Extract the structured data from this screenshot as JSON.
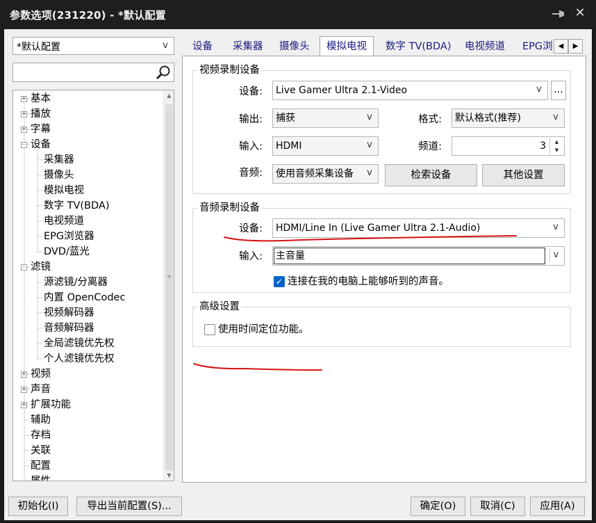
{
  "window": {
    "title": "参数选项(231220) - *默认配置"
  },
  "left": {
    "profile_value": "*默认配置",
    "search_placeholder": "",
    "tree": [
      {
        "label": "基本",
        "level": 0,
        "expander": "+"
      },
      {
        "label": "播放",
        "level": 0,
        "expander": "+"
      },
      {
        "label": "字幕",
        "level": 0,
        "expander": "+"
      },
      {
        "label": "设备",
        "level": 0,
        "expander": "-"
      },
      {
        "label": "采集器",
        "level": 1,
        "expander": ""
      },
      {
        "label": "摄像头",
        "level": 1,
        "expander": ""
      },
      {
        "label": "模拟电视",
        "level": 1,
        "expander": ""
      },
      {
        "label": "数字 TV(BDA)",
        "level": 1,
        "expander": ""
      },
      {
        "label": "电视频道",
        "level": 1,
        "expander": ""
      },
      {
        "label": "EPG浏览器",
        "level": 1,
        "expander": ""
      },
      {
        "label": "DVD/蓝光",
        "level": 1,
        "expander": ""
      },
      {
        "label": "滤镜",
        "level": 0,
        "expander": "-"
      },
      {
        "label": "源滤镜/分离器",
        "level": 1,
        "expander": ""
      },
      {
        "label": "内置 OpenCodec",
        "level": 1,
        "expander": ""
      },
      {
        "label": "视频解码器",
        "level": 1,
        "expander": ""
      },
      {
        "label": "音频解码器",
        "level": 1,
        "expander": ""
      },
      {
        "label": "全局滤镜优先权",
        "level": 1,
        "expander": ""
      },
      {
        "label": "个人滤镜优先权",
        "level": 1,
        "expander": ""
      },
      {
        "label": "视频",
        "level": 0,
        "expander": "+"
      },
      {
        "label": "声音",
        "level": 0,
        "expander": "+"
      },
      {
        "label": "扩展功能",
        "level": 0,
        "expander": "+"
      },
      {
        "label": "辅助",
        "level": 0,
        "expander": ""
      },
      {
        "label": "存档",
        "level": 0,
        "expander": ""
      },
      {
        "label": "关联",
        "level": 0,
        "expander": ""
      },
      {
        "label": "配置",
        "level": 0,
        "expander": ""
      },
      {
        "label": "属性",
        "level": 0,
        "expander": ""
      }
    ]
  },
  "tabs": [
    "设备",
    "采集器",
    "摄像头",
    "模拟电视",
    "数字 TV(BDA)",
    "电视频道",
    "EPG浏"
  ],
  "video_group": {
    "title": "视频录制设备",
    "device_label": "设备:",
    "device_value": "Live Gamer Ultra 2.1-Video",
    "more_btn": "...",
    "output_label": "输出:",
    "output_value": "捕获",
    "format_label": "格式:",
    "format_value": "默认格式(推荐)",
    "input_label": "输入:",
    "input_value": "HDMI",
    "channel_label": "频道:",
    "channel_value": "3",
    "audio_label": "音频:",
    "audio_value": "使用音频采集设备",
    "search_btn": "检索设备",
    "other_btn": "其他设置"
  },
  "audio_group": {
    "title": "音频录制设备",
    "device_label": "设备:",
    "device_value": "HDMI/Line In (Live Gamer Ultra 2.1-Audio)",
    "input_label": "输入:",
    "input_value": "主音量",
    "listen_label": "连接在我的电脑上能够听到的声音。",
    "listen_checked": true
  },
  "adv_group": {
    "title": "高级设置",
    "timeshift_label": "使用时间定位功能。",
    "timeshift_checked": false
  },
  "buttons": {
    "init": "初始化(I)",
    "export": "导出当前配置(S)...",
    "ok": "确定(O)",
    "cancel": "取消(C)",
    "apply": "应用(A)"
  },
  "accent_color": "#0b63c5",
  "annotation_color": "#d41414"
}
